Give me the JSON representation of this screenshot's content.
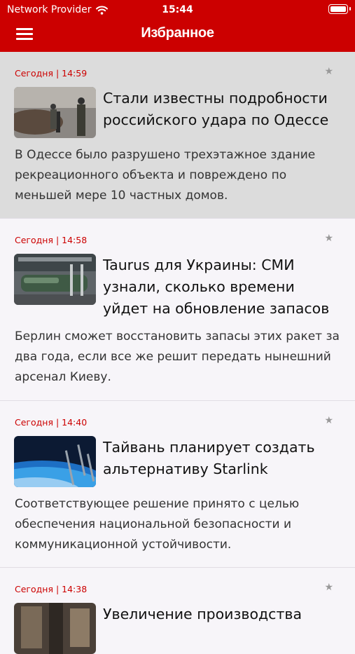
{
  "status_bar": {
    "carrier": "Network Provider",
    "time": "15:44"
  },
  "header": {
    "title": "Избранное"
  },
  "icons": {
    "menu": "hamburger-menu-icon",
    "favorite": "star-icon",
    "wifi": "wifi-icon",
    "battery": "battery-icon"
  },
  "colors": {
    "brand": "#cc0000",
    "highlight_bg": "#dcdcdc",
    "page_bg": "#f7f5f9"
  },
  "articles": [
    {
      "date": "Сегодня",
      "time": "14:59",
      "headline": "Стали известны подробности российского удара по Одессе",
      "summary": "В Одессе было разрушено трехэтажное здание рекреационного объекта и повреждено по меньшей мере 10 частных домов.",
      "star": "★"
    },
    {
      "date": "Сегодня",
      "time": "14:58",
      "headline": "Taurus для Украины: СМИ узнали, сколько времени уйдет на обновление запасов",
      "summary": "Берлин сможет восстановить запасы этих ракет за два года, если все же решит передать нынешний арсенал Киеву.",
      "star": "★"
    },
    {
      "date": "Сегодня",
      "time": "14:40",
      "headline": "Тайвань планирует создать альтернативу Starlink",
      "summary": "Соответствующее решение принято с целью обеспечения национальной безопасности и коммуникационной устойчивости.",
      "star": "★"
    },
    {
      "date": "Сегодня",
      "time": "14:38",
      "headline": "Увеличение производства",
      "summary": "",
      "star": "★"
    }
  ]
}
